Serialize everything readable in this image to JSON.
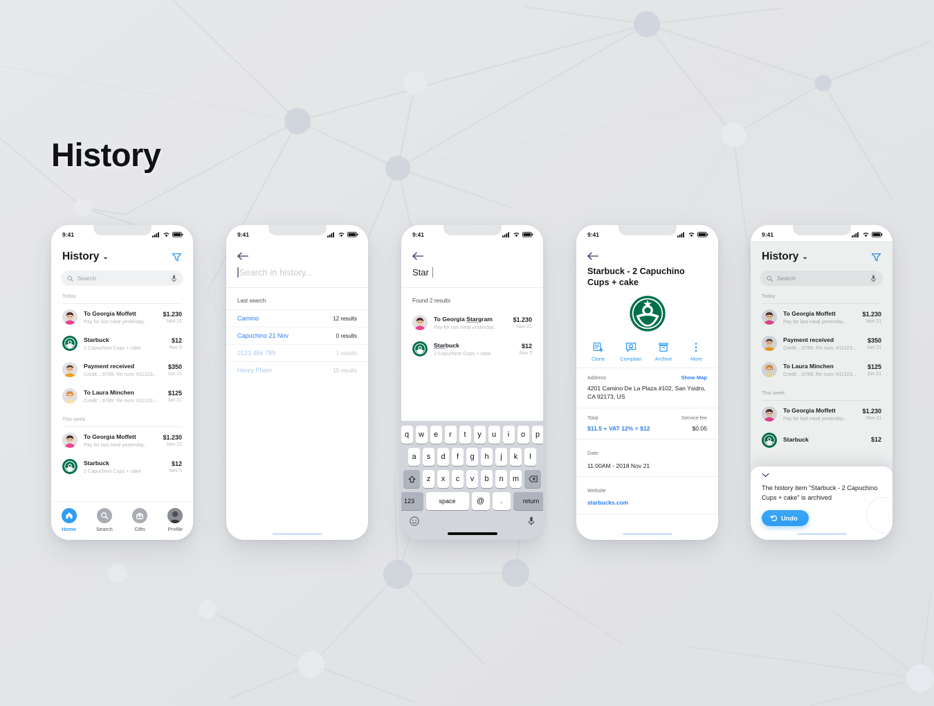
{
  "page": {
    "title": "History",
    "background_color": "#e4e5e7",
    "accent_blue": "#2e9cf6",
    "link_blue": "#2e7ef0",
    "starbucks_green": "#00704a"
  },
  "status_bar": {
    "time": "9:41",
    "icons": [
      "cellular-signal-icon",
      "wifi-icon",
      "battery-icon"
    ]
  },
  "phone1": {
    "header": {
      "title": "History",
      "chevron": "⌄",
      "filter_icon": "filter-icon"
    },
    "search": {
      "placeholder": "Search",
      "search_icon": "search-icon",
      "mic_icon": "microphone-icon"
    },
    "sections": [
      {
        "label": "Today",
        "items": [
          {
            "avatar": "woman-pink",
            "title": "To Georgia Moffett",
            "subtitle": "Pay for last meal yesterday..",
            "amount": "$1.230",
            "date": "Nov 21"
          },
          {
            "avatar": "starbucks",
            "title": "Starbuck",
            "subtitle": "2 Capuchino Cups + cake",
            "amount": "$12",
            "date": "Nov 5"
          },
          {
            "avatar": "man-orange",
            "title": "Payment received",
            "subtitle": "Credit ...6789. Re num: #11223...",
            "amount": "$350",
            "date": "Jun 21"
          },
          {
            "avatar": "woman-ginger",
            "title": "To Laura Minchen",
            "subtitle": "Credit ...6789. Re num: #11223...",
            "amount": "$125",
            "date": "Jun 21"
          }
        ]
      },
      {
        "label": "This week",
        "items": [
          {
            "avatar": "woman-pink",
            "title": "To Georgia Moffett",
            "subtitle": "Pay for last meal yesterday..",
            "amount": "$1.230",
            "date": "Nov 21"
          },
          {
            "avatar": "starbucks",
            "title": "Starbuck",
            "subtitle": "2 Capuchino Cups + cake",
            "amount": "$12",
            "date": "Nov 5"
          }
        ]
      }
    ],
    "tabs": [
      {
        "label": "Home",
        "icon": "home-icon",
        "active": true
      },
      {
        "label": "Search",
        "icon": "search-icon",
        "active": false
      },
      {
        "label": "Gifts",
        "icon": "gift-icon",
        "active": false
      },
      {
        "label": "Profile",
        "icon": "avatar-icon",
        "active": false
      }
    ]
  },
  "phone2": {
    "back_icon": "back-arrow-icon",
    "search_placeholder": "Search in history...",
    "last_search_label": "Last search",
    "results": [
      {
        "term": "Camino",
        "count": "12 results",
        "dim": false
      },
      {
        "term": "Capuchino 21 Nov",
        "count": "0 results",
        "dim": false
      },
      {
        "term": "0123 456 789",
        "count": "1 results",
        "dim": true
      },
      {
        "term": "Henry Pham",
        "count": "15 results",
        "dim": true
      }
    ]
  },
  "phone3": {
    "back_icon": "back-arrow-icon",
    "query": "Star",
    "found_label": "Found 2 results",
    "results": [
      {
        "avatar": "woman-pink",
        "title_hl": "Star",
        "title_rest": "gram",
        "title_pre": "To Georgia ",
        "subtitle": "Pay for last meal yesterday..",
        "amount": "$1.230",
        "date": "Nov 21"
      },
      {
        "avatar": "starbucks",
        "title_hl": "Star",
        "title_rest": "buck",
        "title_pre": "",
        "subtitle": "2 Capuchino Cups + cake",
        "amount": "$12",
        "date": "Nov 5"
      }
    ],
    "keyboard": {
      "row1": [
        "q",
        "w",
        "e",
        "r",
        "t",
        "y",
        "u",
        "i",
        "o",
        "p"
      ],
      "row2": [
        "a",
        "s",
        "d",
        "f",
        "g",
        "h",
        "j",
        "k",
        "l"
      ],
      "row3": [
        "z",
        "x",
        "c",
        "v",
        "b",
        "n",
        "m"
      ],
      "shift_icon": "shift-icon",
      "backspace_icon": "backspace-icon",
      "numbers_key": "123",
      "space_key": "space",
      "at_key": "@",
      "period_key": ".",
      "return_key": "return",
      "emoji_icon": "emoji-icon",
      "dictate_icon": "microphone-icon"
    }
  },
  "phone4": {
    "back_icon": "back-arrow-icon",
    "title": "Starbuck - 2 Capuchino Cups + cake",
    "logo": "starbucks-logo",
    "actions": [
      {
        "label": "Clone",
        "icon": "clone-icon"
      },
      {
        "label": "Complain",
        "icon": "complain-icon"
      },
      {
        "label": "Archive",
        "icon": "archive-icon"
      },
      {
        "label": "More",
        "icon": "more-dots-icon"
      }
    ],
    "address": {
      "key": "Address",
      "link": "Show Map",
      "value": "4201 Camino De La Plaza #102, San Ysidro, CA 92173, US"
    },
    "total": {
      "key": "Total",
      "value": "$11.5 + VAT 12% = $12",
      "fee_key": "Service fee",
      "fee_value": "$0.05"
    },
    "date": {
      "key": "Date",
      "value": "11:00AM - 2018 Nov 21"
    },
    "website": {
      "key": "Website",
      "value": "starbucks.com"
    }
  },
  "phone5": {
    "header": {
      "title": "History",
      "chevron": "⌄",
      "filter_icon": "filter-icon"
    },
    "search": {
      "placeholder": "Search",
      "search_icon": "search-icon",
      "mic_icon": "microphone-icon"
    },
    "sections": [
      {
        "label": "Today",
        "items": [
          {
            "avatar": "woman-pink",
            "title": "To Georgia Moffett",
            "subtitle": "Pay for last meal yesterday..",
            "amount": "$1.230",
            "date": "Nov 21"
          },
          {
            "avatar": "man-orange",
            "title": "Payment received",
            "subtitle": "Credit ...6789. Re num: #11223...",
            "amount": "$350",
            "date": "Jun 21"
          },
          {
            "avatar": "woman-ginger",
            "title": "To Laura Minchen",
            "subtitle": "Credit ...6789. Re num: #11223...",
            "amount": "$125",
            "date": "Jun 21"
          }
        ]
      },
      {
        "label": "This week",
        "items": [
          {
            "avatar": "woman-pink",
            "title": "To Georgia Moffett",
            "subtitle": "Pay for last meal yesterday..",
            "amount": "$1.230",
            "date": "Nov 21"
          },
          {
            "avatar": "starbucks",
            "title": "Starbuck",
            "subtitle": "",
            "amount": "$12",
            "date": ""
          }
        ]
      }
    ],
    "sheet": {
      "chevron_icon": "chevron-down-icon",
      "message": "The history item \"Starbuck - 2 Capuchino Cups + cake\" is archived",
      "undo_label": "Undo",
      "undo_icon": "undo-icon"
    }
  }
}
